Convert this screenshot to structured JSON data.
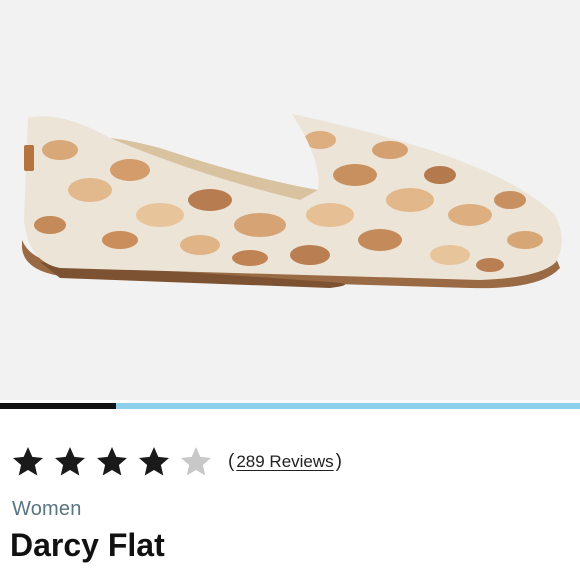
{
  "product": {
    "image_alt": "Darcy Flat shoe, natural canvas with tan animal-spot print",
    "rating": 4,
    "rating_max": 5,
    "review_count_label": "289 Reviews",
    "review_open_paren": "(",
    "review_close_paren": ")",
    "category": "Women",
    "name": "Darcy Flat"
  },
  "gallery": {
    "progress": 0.2
  },
  "colors": {
    "star_filled": "#1a1a1a",
    "star_empty": "#c8c8c8",
    "progress_track": "#8fd0ea",
    "progress_fill": "#111111"
  }
}
